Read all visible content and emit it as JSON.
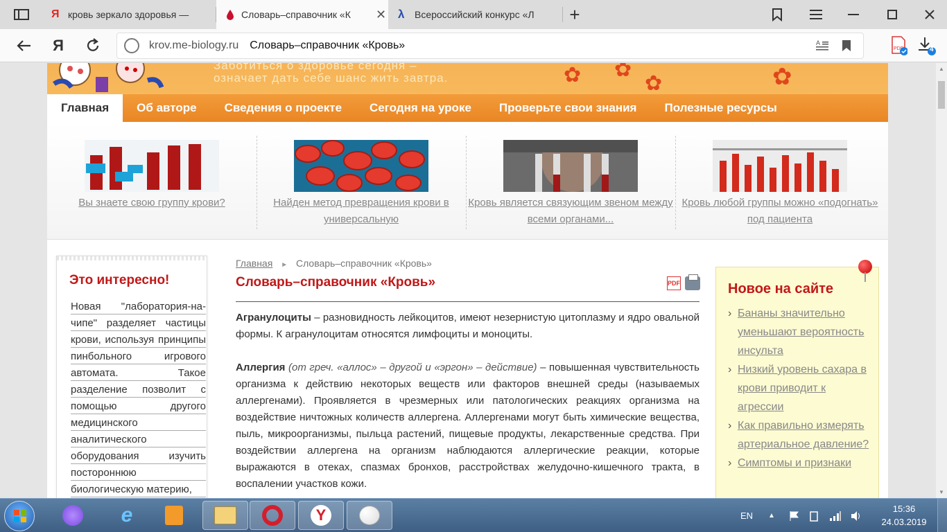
{
  "browser": {
    "tabs": [
      {
        "title": "кровь зеркало здоровья —",
        "favicon_color": "#e52620",
        "active": false
      },
      {
        "title": "Словарь–справочник «К",
        "favicon_color": "#c8102e",
        "active": true
      },
      {
        "title": "Всероссийский конкурс «Л",
        "favicon_color": "#2a4db0",
        "active": false
      }
    ],
    "new_tab_label": "+",
    "address": {
      "domain": "krov.me-biology.ru",
      "page_title": "Словарь–справочник «Кровь»"
    },
    "downloads_badge": "4"
  },
  "site": {
    "slogan_line1": "Заботиться о здоровье сегодня –",
    "slogan_line2": "означает дать себе шанс жить завтра.",
    "nav": [
      "Главная",
      "Об авторе",
      "Сведения о проекте",
      "Сегодня на уроке",
      "Проверьте свои знания",
      "Полезные ресурсы"
    ],
    "featured": [
      {
        "caption": "Вы знаете свою группу крови?"
      },
      {
        "caption": "Найден метод превращения крови в универсальную"
      },
      {
        "caption": "Кровь является связующим звеном между всеми органами..."
      },
      {
        "caption": "Кровь любой группы можно «подогнать» под пациента"
      }
    ],
    "interesting": {
      "title": "Это интересно!",
      "text": "Новая \"лаборатория-на-чипе\" разделяет частицы крови, используя принципы пинбольного игрового автомата. Такое разделение позволит с помощью другого медицинского аналитического оборудования изучить постороннюю биологическую материю,"
    },
    "breadcrumb": {
      "home": "Главная",
      "current": "Словарь–справочник «Кровь»"
    },
    "article_title": "Словарь–справочник «Кровь»",
    "entries": [
      {
        "term": "Агранулоциты",
        "etym": "",
        "text": " – разновидность лейкоцитов, имеют незернистую цитоплазму и ядро овальной формы. К агранулоцитам относятся лимфоциты и моноциты."
      },
      {
        "term": "Аллергия",
        "etym": " (от греч. «аллос» – другой и «эргон» – действие)",
        "text": " – повышенная чувствительность организма к действию некоторых веществ или факторов внешней среды (называемых аллергенами). Проявляется в чрезмерных или патологических реакциях организма на воздействие ничтожных количеств аллергена. Аллергенами могут быть химические вещества, пыль, микроорганизмы, пыльца растений, пищевые продукты, лекарственные средства. При воздействии аллергена на организм наблюдаются аллергические реакции, которые выражаются в отеках, спазмах бронхов, расстройствах желудочно-кишечного тракта, в воспалении участков кожи."
      }
    ],
    "news": {
      "title": "Новое на сайте",
      "items": [
        "Бананы значительно уменьшают вероятность инсульта",
        "Низкий уровень сахара в крови приводит к агрессии",
        "Как правильно измерять артериальное давление?",
        "Симптомы и признаки"
      ]
    }
  },
  "taskbar": {
    "language": "EN",
    "time": "15:36",
    "date": "24.03.2019"
  }
}
